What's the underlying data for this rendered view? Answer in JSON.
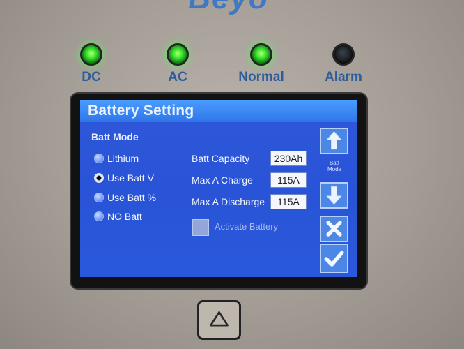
{
  "device": {
    "brand": "Beyo"
  },
  "indicators": [
    {
      "label": "DC",
      "state": "on"
    },
    {
      "label": "AC",
      "state": "on"
    },
    {
      "label": "Normal",
      "state": "on"
    },
    {
      "label": "Alarm",
      "state": "off"
    }
  ],
  "screen": {
    "title": "Battery Setting",
    "batt_mode_label": "Batt Mode",
    "batt_mode_options": [
      {
        "label": "Lithium",
        "selected": false
      },
      {
        "label": "Use Batt V",
        "selected": true
      },
      {
        "label": "Use Batt %",
        "selected": false
      },
      {
        "label": "NO Batt",
        "selected": false
      }
    ],
    "fields": [
      {
        "label": "Batt Capacity",
        "value": "230Ah"
      },
      {
        "label": "Max A Charge",
        "value": "115A"
      },
      {
        "label": "Max A Discharge",
        "value": "115A"
      }
    ],
    "activate_battery_label": "Activate Battery",
    "side_buttons": {
      "up_icon": "up-arrow-icon",
      "mode_label_line1": "Batt",
      "mode_label_line2": "Mode",
      "down_icon": "down-arrow-icon",
      "cancel_icon": "x-icon",
      "confirm_icon": "check-icon"
    }
  },
  "physical_button": {
    "icon": "triangle-up-icon"
  },
  "colors": {
    "screen_blue": "#2c56d8",
    "title_bar_blue": "#3c8cff",
    "led_green": "#37e52d",
    "label_blue": "#2c5d9a"
  }
}
